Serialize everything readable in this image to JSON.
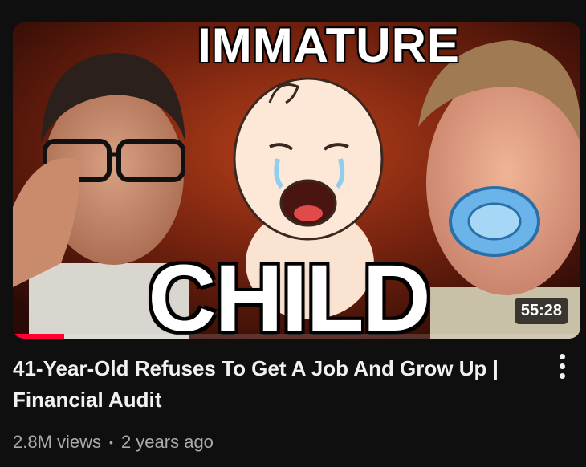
{
  "video": {
    "thumbnail_text_top": "IMMATURE",
    "thumbnail_text_bottom": "CHILD",
    "duration": "55:28",
    "watched_progress": 0.09,
    "title": "41-Year-Old Refuses To Get A Job And Grow Up | Financial Audit",
    "views": "2.8M views",
    "separator": "•",
    "age": "2 years ago"
  },
  "icons": {
    "menu": "more-vertical-icon"
  },
  "colors": {
    "background": "#0f0f0f",
    "progress": "#ff0033",
    "title": "#f1f1f1",
    "meta": "#aaaaaa"
  }
}
